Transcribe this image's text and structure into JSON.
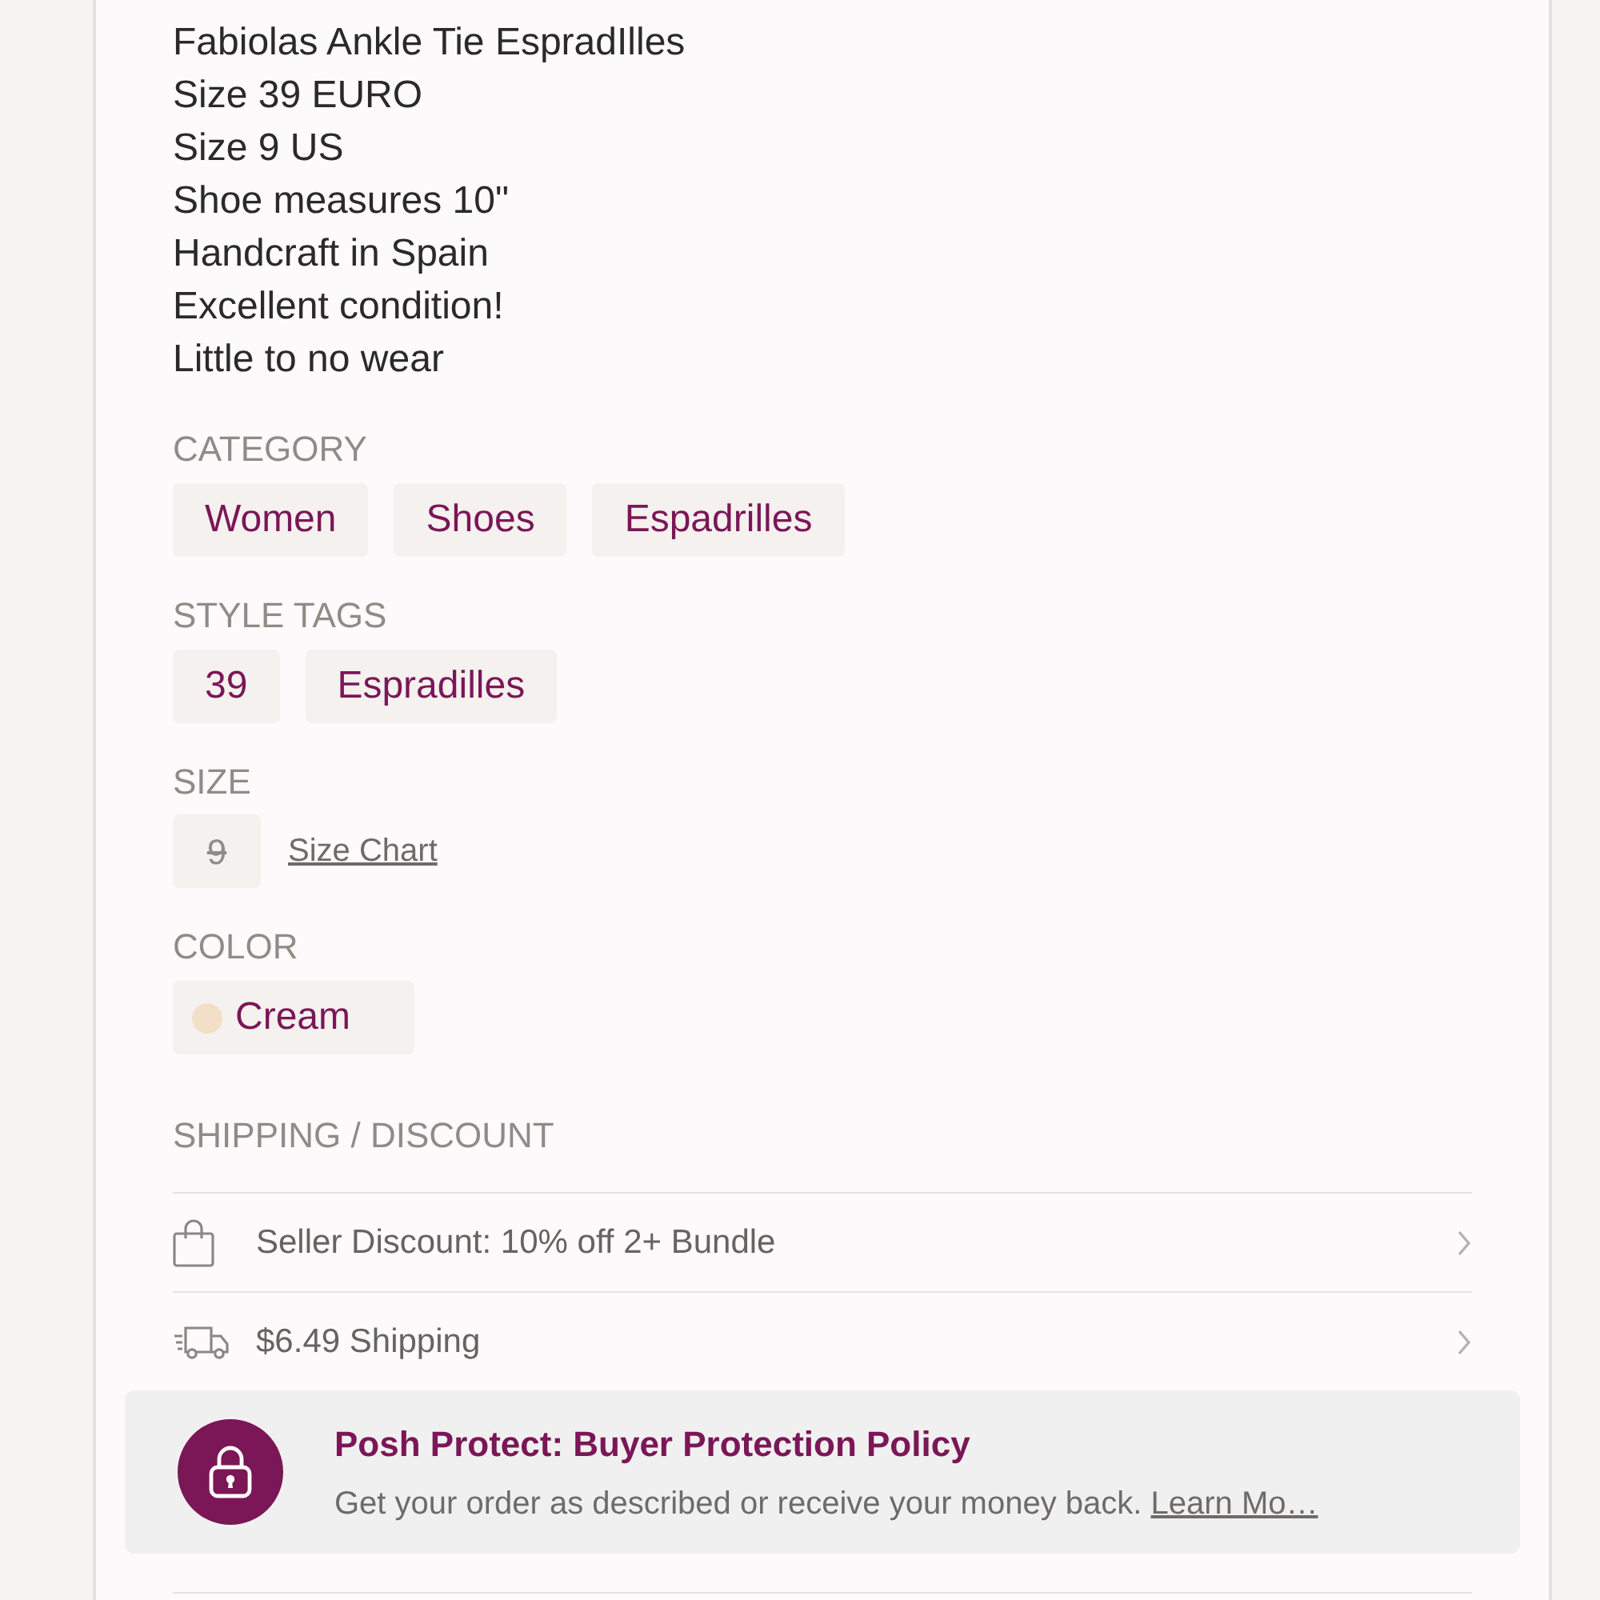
{
  "description": [
    "Fabiolas Ankle Tie EspradIlles",
    "Size 39 EURO",
    "Size 9 US",
    "Shoe measures 10\"",
    "Handcraft in Spain",
    "Excellent condition!",
    "Little to no wear"
  ],
  "sections": [
    {
      "kind": "tags",
      "heading": "CATEGORY",
      "tags": [
        "Women",
        "Shoes",
        "Espadrilles"
      ]
    },
    {
      "kind": "tags",
      "heading": "STYLE TAGS",
      "tags": [
        "39",
        "Espradilles"
      ]
    },
    {
      "kind": "size",
      "heading": "SIZE",
      "size": {
        "label": "9",
        "available": false
      },
      "link": "Size Chart"
    },
    {
      "kind": "color",
      "heading": "COLOR",
      "colors": [
        {
          "name": "Cream",
          "color": "#f3dfc8"
        }
      ]
    }
  ],
  "shipping": {
    "heading": "SHIPPING / DISCOUNT",
    "rows": [
      {
        "kind": "discount",
        "text": "Seller Discount: 10% off 2+ Bundle"
      },
      {
        "kind": "shipping",
        "text": "$6.49 Shipping"
      }
    ]
  },
  "protection": {
    "title": "Posh Protect: Buyer Protection Policy",
    "text": "Get your order as described or receive your money back.",
    "link": "Learn Mo…"
  }
}
